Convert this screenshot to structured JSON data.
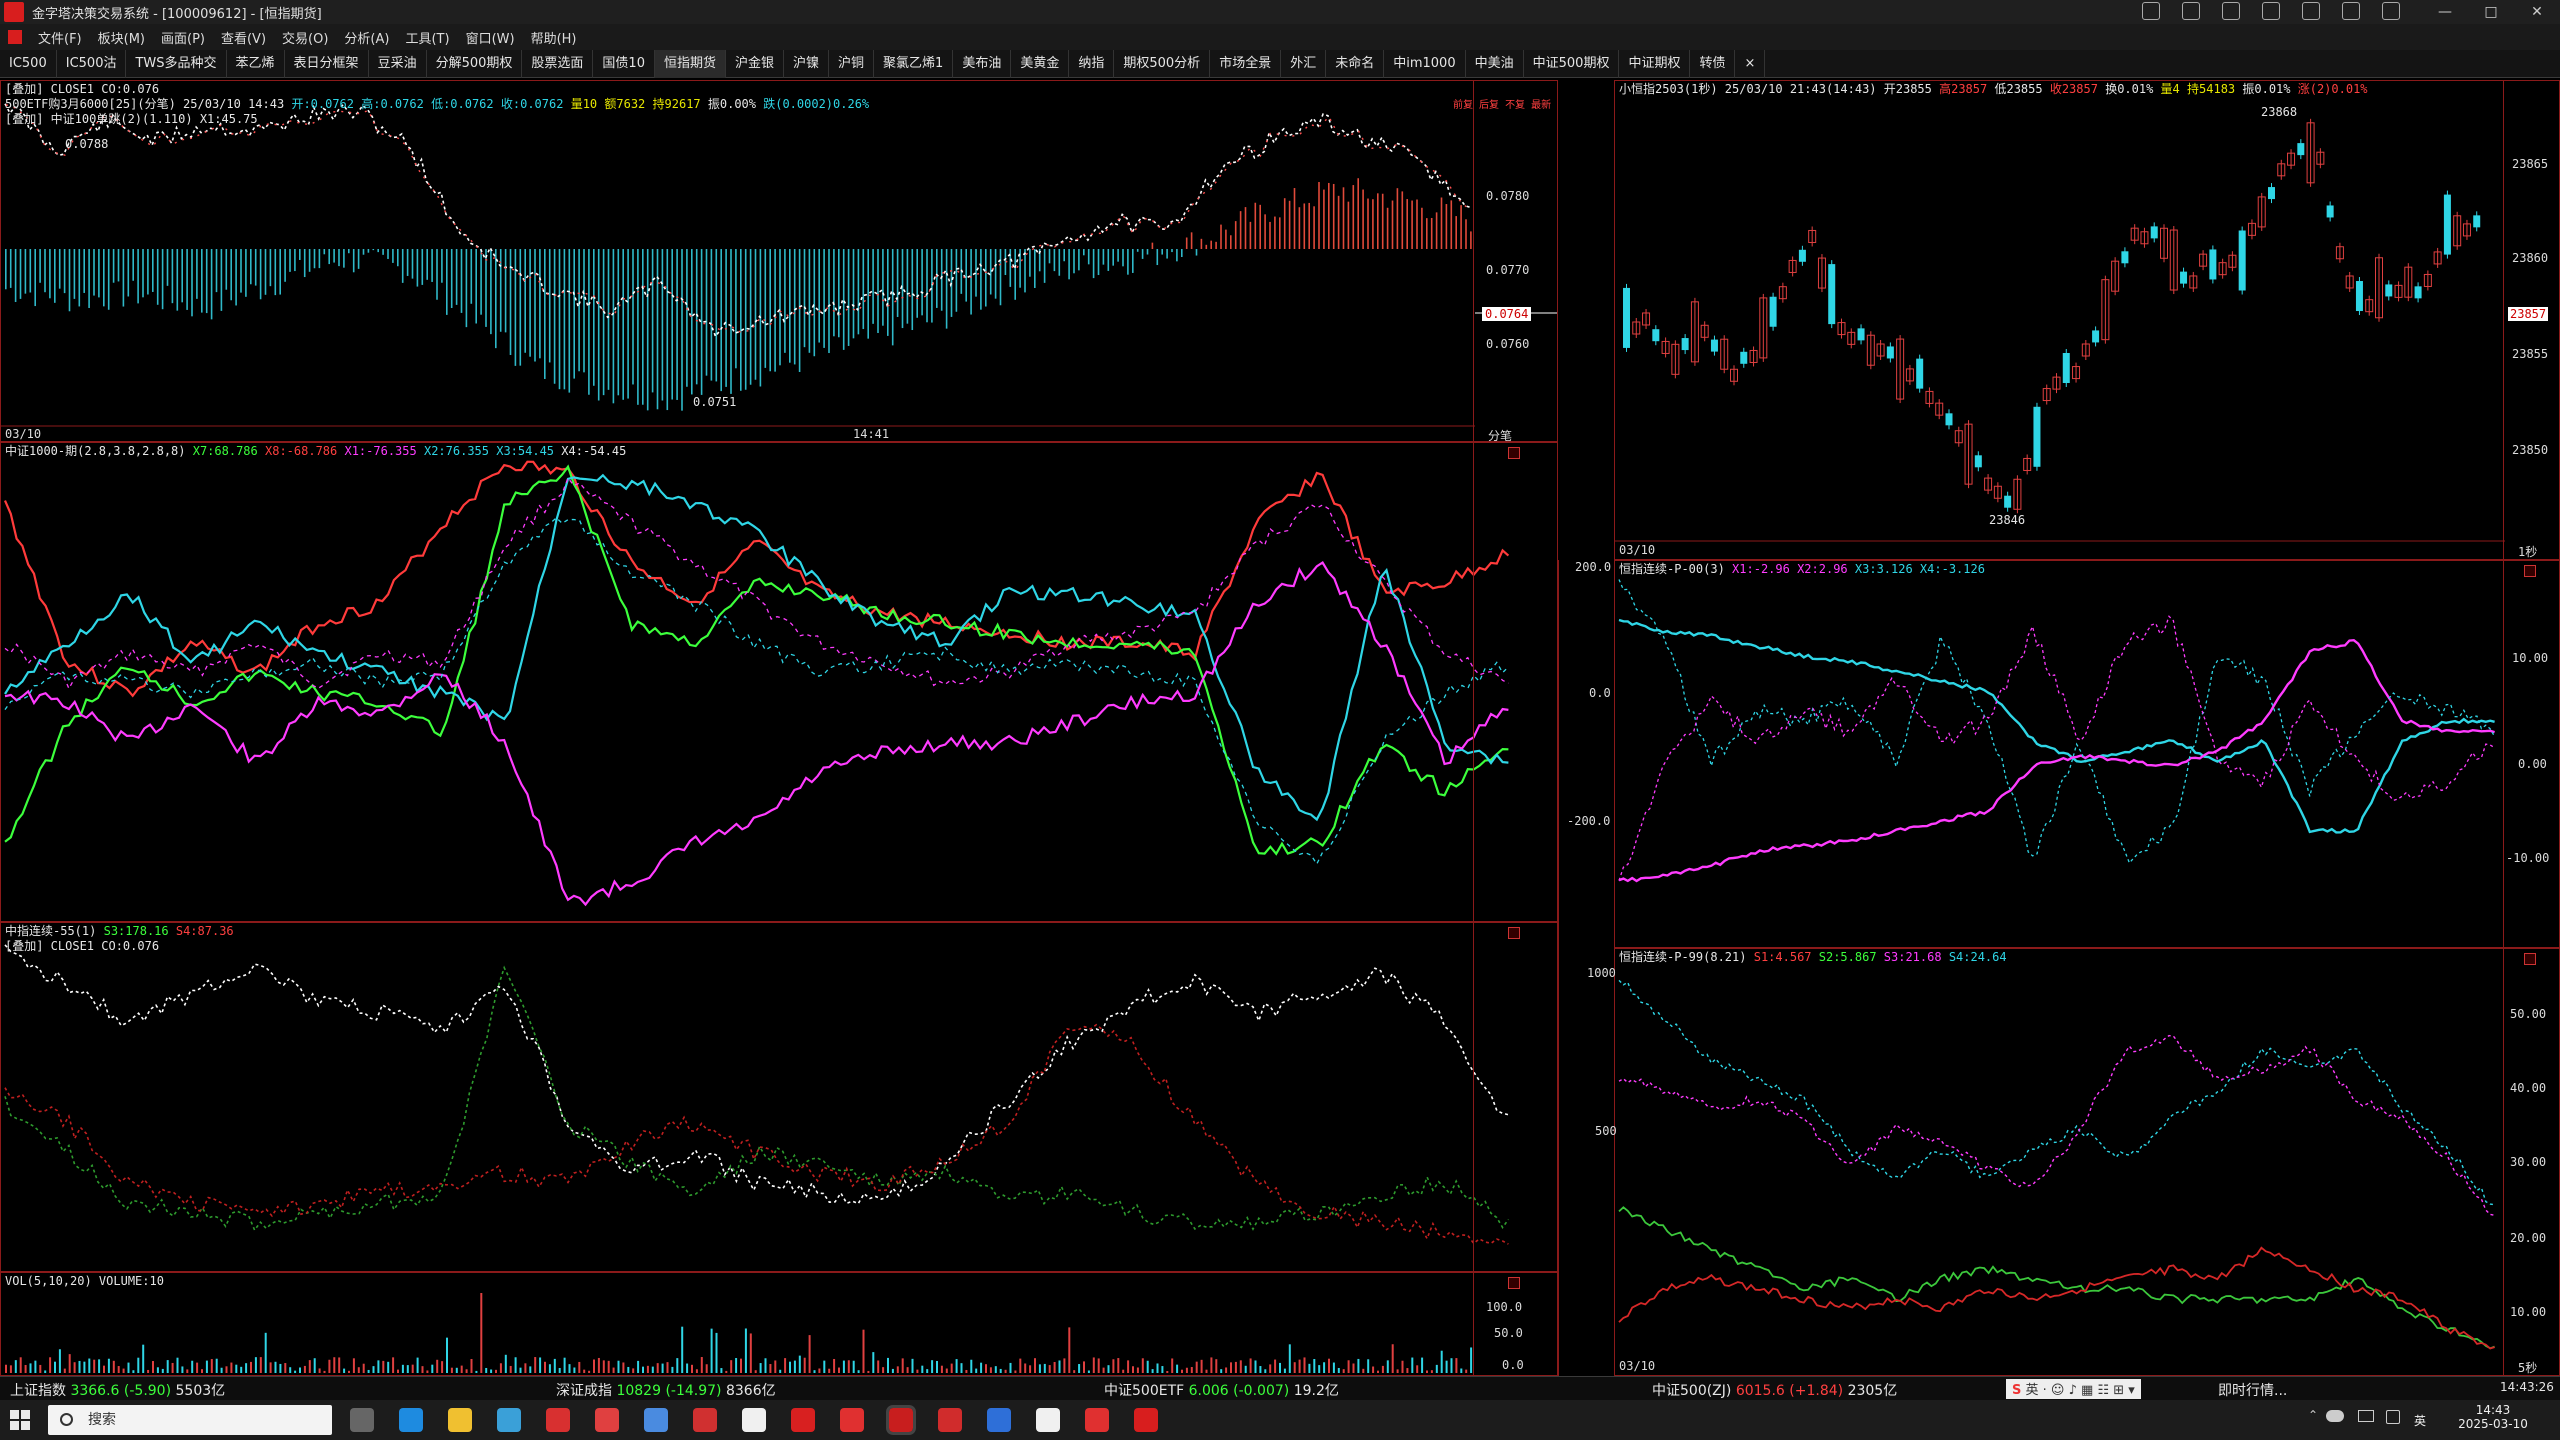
{
  "window": {
    "title": "金字塔决策交易系统 - [100009612] - [恒指期货]"
  },
  "menu": {
    "items": [
      "文件(F)",
      "板块(M)",
      "画面(P)",
      "查看(V)",
      "交易(O)",
      "分析(A)",
      "工具(T)",
      "窗口(W)",
      "帮助(H)"
    ]
  },
  "tabs": {
    "items": [
      "IC500",
      "IC500沽",
      "TWS多品种交",
      "苯乙烯",
      "表日分框架",
      "豆采油",
      "分解500期权",
      "股票选面",
      "国债10",
      "恒指期货",
      "沪金银",
      "沪镍",
      "沪铜",
      "聚氯乙烯1",
      "美布油",
      "美黄金",
      "纳指",
      "期权500分析",
      "市场全景",
      "外汇",
      "未命名",
      "中im1000",
      "中美油",
      "中证500期权",
      "中证期权",
      "转债"
    ],
    "close": "×"
  },
  "panel_main": {
    "line1": "[叠加] CLOSE1 CO:0.076",
    "line2_prefix": "500ETF购3月6000[25](分笔) 25/03/10 14:43",
    "line2_open": "开:0.0762",
    "line2_high": "高:0.0762",
    "line2_low": "低:0.0762",
    "line2_close": "收:0.0762",
    "line2_vol": "量10",
    "line2_amt": "额7632",
    "line2_hold": "持92617",
    "line2_amp": "振0.00%",
    "line2_chg": "跌(0.0002)0.26%",
    "line3": "[叠加] 中证100单跳(2)(1.110) X1:45.75",
    "axis": [
      "0.0780",
      "0.0770",
      "0.0764",
      "0.0760"
    ],
    "max_label": "0.0788",
    "min_label": "0.0751",
    "date": "03/10",
    "time": "14:41",
    "right_label": "分笔",
    "mini_buttons": [
      "前复",
      "后复",
      "不复",
      "最新"
    ]
  },
  "panel_ind1": {
    "title": "中证1000-期(2.8,3.8,2.8,8)",
    "x7": "X7:68.786",
    "x8": "X8:-68.786",
    "x1": "X1:-76.355",
    "x2": "X2:76.355",
    "x3": "X3:54.45",
    "x4": "X4:-54.45"
  },
  "panel_ind2": {
    "title": "中指连续-55(1)",
    "s3": "S3:178.16",
    "s4": "S4:87.36",
    "line2": "[叠加] CLOSE1 CO:0.076"
  },
  "panel_vol": {
    "title": "VOL(5,10,20) VOLUME:10",
    "axis": [
      "100.0",
      "50.0",
      "0.0"
    ]
  },
  "panel_hsi": {
    "header": "小恒指2503(1秒) 25/03/10 21:43(14:43)",
    "open": "开23855",
    "high": "高23857",
    "low": "低23855",
    "close": "收23857",
    "chg": "换0.01%",
    "vol": "量4",
    "hold": "持54183",
    "amp": "振0.01%",
    "rise": "涨(2)0.01%",
    "axis": [
      "23865",
      "23860",
      "23857",
      "23855",
      "23850"
    ],
    "max_label": "23868",
    "min_label": "23846",
    "date": "03/10",
    "period": "1秒"
  },
  "panel_hsi2": {
    "title": "恒指连续-P-00(3)",
    "x1": "X1:-2.96",
    "x2": "X2:2.96",
    "x3": "X3:3.126",
    "x4": "X4:-3.126",
    "axis_left": [
      "200.0",
      "0.0",
      "-200.0"
    ],
    "axis_right": [
      "10.00",
      "0.00",
      "-10.00"
    ]
  },
  "panel_hsi3": {
    "title": "恒指连续-P-99(8.21)",
    "s1": "S1:4.567",
    "s2": "S2:5.867",
    "s3": "S3:21.68",
    "s4": "S4:24.64",
    "axis_left": [
      "1000",
      "500"
    ],
    "axis_right": [
      "50.00",
      "40.00",
      "30.00",
      "20.00",
      "10.00"
    ],
    "date": "03/10",
    "period": "5秒"
  },
  "statusbar": {
    "sh_name": "上证指数",
    "sh_val": "3366.6",
    "sh_chg": "(-5.90)",
    "sh_amt": "5503亿",
    "sz_name": "深证成指",
    "sz_val": "10829",
    "sz_chg": "(-14.97)",
    "sz_amt": "8366亿",
    "etf_name": "中证500ETF",
    "etf_val": "6.006",
    "etf_chg": "(-0.007)",
    "etf_amt": "19.2亿",
    "zz_name": "中证500(ZJ)",
    "zz_val": "6015.6",
    "zz_chg": "(+1.84)",
    "zz_amt": "2305亿",
    "news": "即时行情...",
    "clock": "14:43:26"
  },
  "taskbar": {
    "search": "搜索",
    "time": "14:43",
    "date": "2025-03-10",
    "ime": "英"
  },
  "colors": {
    "panel_border": "#8b1a1a",
    "up": "#ff3b3b",
    "down": "#2fd6e6",
    "green": "#3cff3c",
    "magenta": "#ff3cff"
  }
}
